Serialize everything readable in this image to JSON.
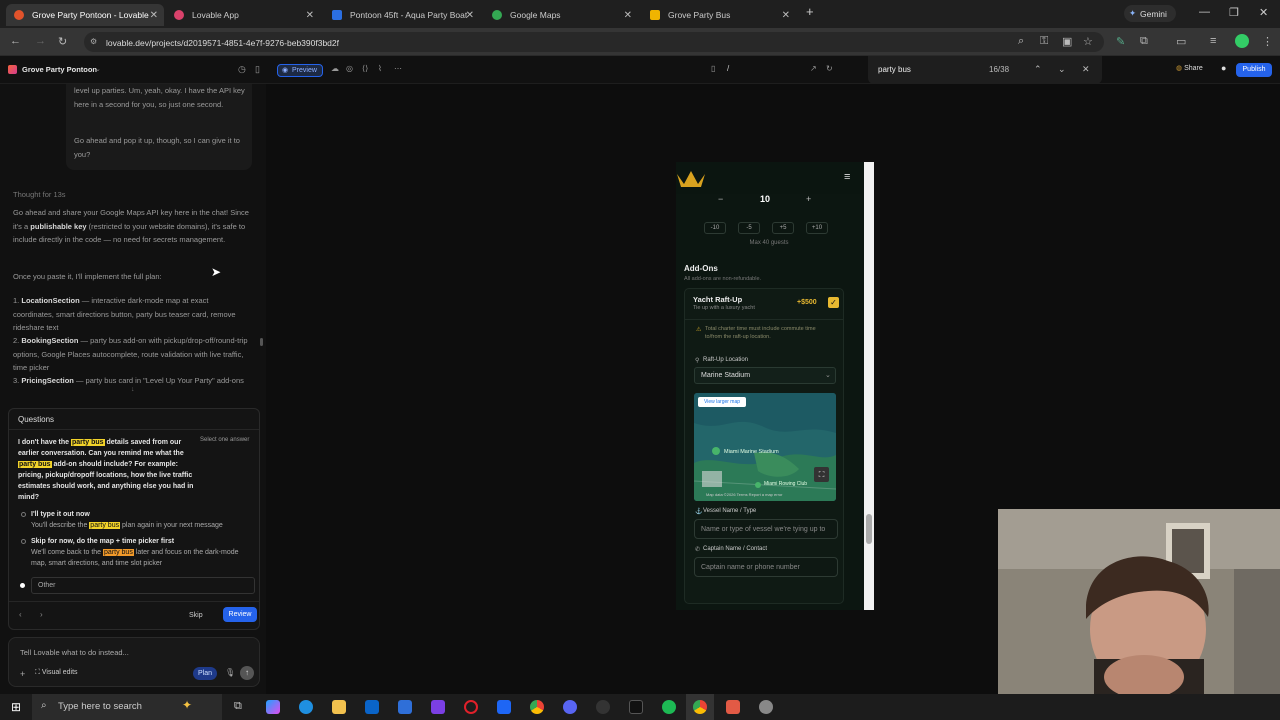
{
  "tabs": [
    {
      "title": "Grove Party Pontoon - Lovable",
      "active": true,
      "fav_color": "#e2532b"
    },
    {
      "title": "Lovable App",
      "active": false,
      "fav_color": "#d9426b"
    },
    {
      "title": "Pontoon 45ft - Aqua Party Boat",
      "active": false,
      "fav_color": "#2b6fe2"
    },
    {
      "title": "Google Maps",
      "active": false,
      "fav_color": "#34a853"
    },
    {
      "title": "Grove Party Bus",
      "active": false,
      "fav_color": "#f0b400"
    }
  ],
  "browser": {
    "url": "lovable.dev/projects/d2019571-4851-4e7f-9276-beb390f3bd2f",
    "profile_label": "Gemini",
    "new_tab": "+"
  },
  "app_toolbar": {
    "project_name": "Grove Party Pontoon",
    "preview_label": "Preview",
    "path_value": "/",
    "find_query": "party bus",
    "find_count": "16/38",
    "share_label": "Share",
    "publish_label": "Publish"
  },
  "chat": {
    "user_msg_1": "level up parties. Um, yeah, okay. I have the API key here in a second for you, so just one second.",
    "user_msg_2": "Go ahead and pop it up, though, so I can give it to you?",
    "thought": "Thought for 13s",
    "reply_1a": "Go ahead and share your Google Maps API key here in the chat! Since it's a ",
    "reply_1b": "publishable key",
    "reply_1c": " (restricted to your website domains), it's safe to include directly in the code — no need for secrets management.",
    "reply_2": "Once you paste it, I'll implement the full plan:",
    "plan": [
      {
        "num": "1.",
        "title": "LocationSection",
        "desc": " — interactive dark-mode map at exact coordinates, smart directions button, party bus teaser card, remove rideshare text"
      },
      {
        "num": "2.",
        "title": "BookingSection",
        "desc": " — party bus add-on with pickup/drop-off/round-trip options, Google Places autocomplete, route validation with live traffic, time picker"
      },
      {
        "num": "3.",
        "title": "PricingSection",
        "desc": " — party bus card in \"Level Up Your Party\" add-ons"
      }
    ]
  },
  "questions": {
    "header": "Questions",
    "select_hint": "Select one answer",
    "q_part1": "I don't have the ",
    "q_hl1": "party bus",
    "q_part2": " details saved from our earlier conversation. Can you remind me what the ",
    "q_hl2": "party bus",
    "q_part3": " add-on should include? For example: pricing, pickup/dropoff locations, how the live traffic estimates should work, and anything else you had in mind?",
    "opt1_title": "I'll type it out now",
    "opt1_a": "You'll describe the ",
    "opt1_hl": "party bus",
    "opt1_b": " plan again in your next message",
    "opt2_title": "Skip for now, do the map + time picker first",
    "opt2_a": "We'll come back to the ",
    "opt2_hl": "party bus",
    "opt2_b": " later and focus on the dark-mode map, smart directions, and time slot picker",
    "other_label": "Other",
    "skip_label": "Skip",
    "review_label": "Review"
  },
  "composer": {
    "placeholder": "Tell Lovable what to do instead...",
    "visual_edits_label": "Visual edits",
    "plan_label": "Plan"
  },
  "phone": {
    "guest_count": "10",
    "minus": "−",
    "plus": "+",
    "steps": [
      "-10",
      "-5",
      "+5",
      "+10"
    ],
    "max_guests": "Max 40 guests",
    "addons_title": "Add-Ons",
    "addons_note": "All add-ons are non-refundable.",
    "raftup_title": "Yacht Raft-Up",
    "raftup_sub": "Tie up with a luxury yacht",
    "raftup_price": "+$500",
    "raftup_warning": "Total charter time must include commute time to/from the raft-up location.",
    "raft_location_label": "Raft-Up Location",
    "raft_location_value": "Marine Stadium",
    "view_larger_map": "View larger map",
    "map_label": "Miami Marine Stadium",
    "map_label2": "Miami Rowing Club",
    "map_footer": "Map data ©2026  Terms  Report a map error",
    "vessel_label": "Vessel Name / Type",
    "vessel_placeholder": "Name or type of vessel we're tying up to",
    "captain_label": "Captain Name / Contact",
    "captain_placeholder": "Captain name or phone number"
  },
  "taskbar": {
    "search_placeholder": "Type here to search"
  },
  "colors": {
    "accent_blue": "#2563eb",
    "highlight_yellow": "#f2d32a",
    "gold": "#d9a21f",
    "addon_price": "#e8b931"
  }
}
